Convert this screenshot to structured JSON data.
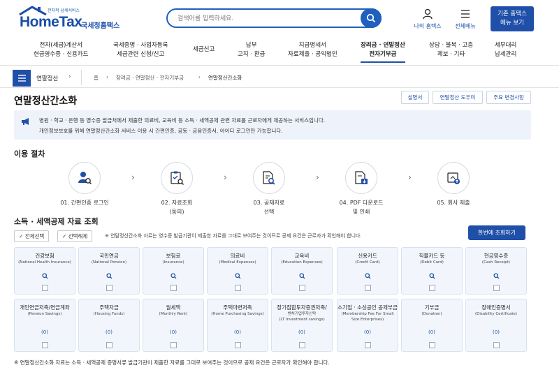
{
  "header": {
    "logo_small": "전자적 납세서비스",
    "logo_main": "HomeTax",
    "logo_sub": "국세청홈택스",
    "search_placeholder": "검색어를 입력하세요.",
    "my_hometax": "나의 홈택스",
    "all_menu": "전체메뉴",
    "legacy_line1": "기존 홈택스",
    "legacy_line2": "메뉴 보기"
  },
  "nav": [
    {
      "l1": "전자(세금)계산서",
      "l2": "현금영수증 · 신용카드"
    },
    {
      "l1": "국세증명 · 사업자등록",
      "l2": "세금관련 신청/신고"
    },
    {
      "l1": "세금신고",
      "l2": ""
    },
    {
      "l1": "납부",
      "l2": "고지 · 환급"
    },
    {
      "l1": "지급명세서",
      "l2": "자료제출 · 공익법인"
    },
    {
      "l1": "장려금 · 연말정산",
      "l2": "전자기부금"
    },
    {
      "l1": "상담 · 불복 · 고충",
      "l2": "제보 · 기타"
    },
    {
      "l1": "세무대리",
      "l2": "납세관리"
    }
  ],
  "breadcrumb": {
    "section": "연말정산",
    "items": [
      "홈",
      "장려금 · 연말정산 · 전자기부금",
      "연말정산간소화"
    ]
  },
  "page": {
    "title": "연말정산간소화",
    "btn_desc": "설명서",
    "btn_helper": "연말정산 도우미",
    "btn_changes": "주요 변경사항",
    "notice_1": "병원 · 학교 · 은행 등 영수증 발급처에서 제출한 의료비, 교육비 등 소득 · 세액공제 관련 자료를 근로자에게 제공하는 서비스입니다.",
    "notice_2": "개인정보보호를 위해 연말정산간소화 서비스 이용 시 간편인증, 공동 · 금융인증서, 아이디 로그인만 가능합니다."
  },
  "procedure": {
    "title": "이용 절차",
    "steps": [
      {
        "l1": "01. 간편인증 로그인",
        "l2": "",
        "icon": "user-search-icon"
      },
      {
        "l1": "02. 자료조회",
        "l2": "(동의)",
        "icon": "clipboard-search-icon"
      },
      {
        "l1": "03. 공제자료",
        "l2": "선택",
        "icon": "document-search-icon"
      },
      {
        "l1": "04. PDF 다운로드",
        "l2": "및 인쇄",
        "icon": "download-document-icon"
      },
      {
        "l1": "05. 회사 제출",
        "l2": "",
        "icon": "upload-icon"
      }
    ]
  },
  "lookup": {
    "title": "소득 · 세액공제 자료 조회",
    "select_all": "전체선택",
    "deselect": "선택해제",
    "note": "※ 연말정산간소화 자료는 영수증 발급기관이 제출한 자료를 그대로 보여주는 것이므로 공제 요건은 근로자가 확인해야 합니다.",
    "query_all": "한번에 조회하기",
    "row1": [
      {
        "ko": "건강보험",
        "en": "(National Health Insurance)",
        "val": "search-icon"
      },
      {
        "ko": "국민연금",
        "en": "(National Pension)",
        "val": "search-icon"
      },
      {
        "ko": "보험료",
        "en": "(Insurance)",
        "val": "search-icon"
      },
      {
        "ko": "의료비",
        "en": "(Medical Expenses)",
        "val": "search-icon"
      },
      {
        "ko": "교육비",
        "en": "(Education Expenses)",
        "val": "search-icon"
      },
      {
        "ko": "신용카드",
        "en": "(Credit Card)",
        "val": "search-icon"
      },
      {
        "ko": "직불카드 등",
        "en": "(Debit Card)",
        "val": "search-icon"
      },
      {
        "ko": "현금영수증",
        "en": "(Cash Receipt)",
        "val": "search-icon"
      }
    ],
    "row2": [
      {
        "ko": "개인연금저축/연금계좌",
        "en": "(Pension Savings)",
        "en2": "",
        "val": "(0)"
      },
      {
        "ko": "주택자금",
        "en": "(Housing Funds)",
        "en2": "",
        "val": "(0)"
      },
      {
        "ko": "월세액",
        "en": "(Monthly Rent)",
        "en2": "",
        "val": "(0)"
      },
      {
        "ko": "주택마련저축",
        "en": "(Home Purchasing Savings)",
        "en2": "",
        "val": "(0)"
      },
      {
        "ko": "장기집합투자증권저축/",
        "en": "벤처기업투자신탁",
        "en2": "(LT Investment savings)",
        "val": "(0)"
      },
      {
        "ko": "소기업 · 소상공인 공제부금",
        "en": "(Membership Fee For Small",
        "en2": "Size Enterprises)",
        "val": "(0)"
      },
      {
        "ko": "기부금",
        "en": "(Donation)",
        "en2": "",
        "val": "(0)"
      },
      {
        "ko": "장애인증명서",
        "en": "(Disability Certificate)",
        "en2": "",
        "val": "(0)"
      }
    ]
  },
  "footnote": "※ 연말정산간소화 자료는 소득 · 세액공제 증명서류 발급기관이 제출한 자료를 그대로 보여주는 것이므로 공제 요건은 근로자가 확인해야 합니다.",
  "colors": {
    "primary": "#1f4fa8",
    "card_bg": "#f2f6fc",
    "notice_bg": "#eef3fb"
  }
}
